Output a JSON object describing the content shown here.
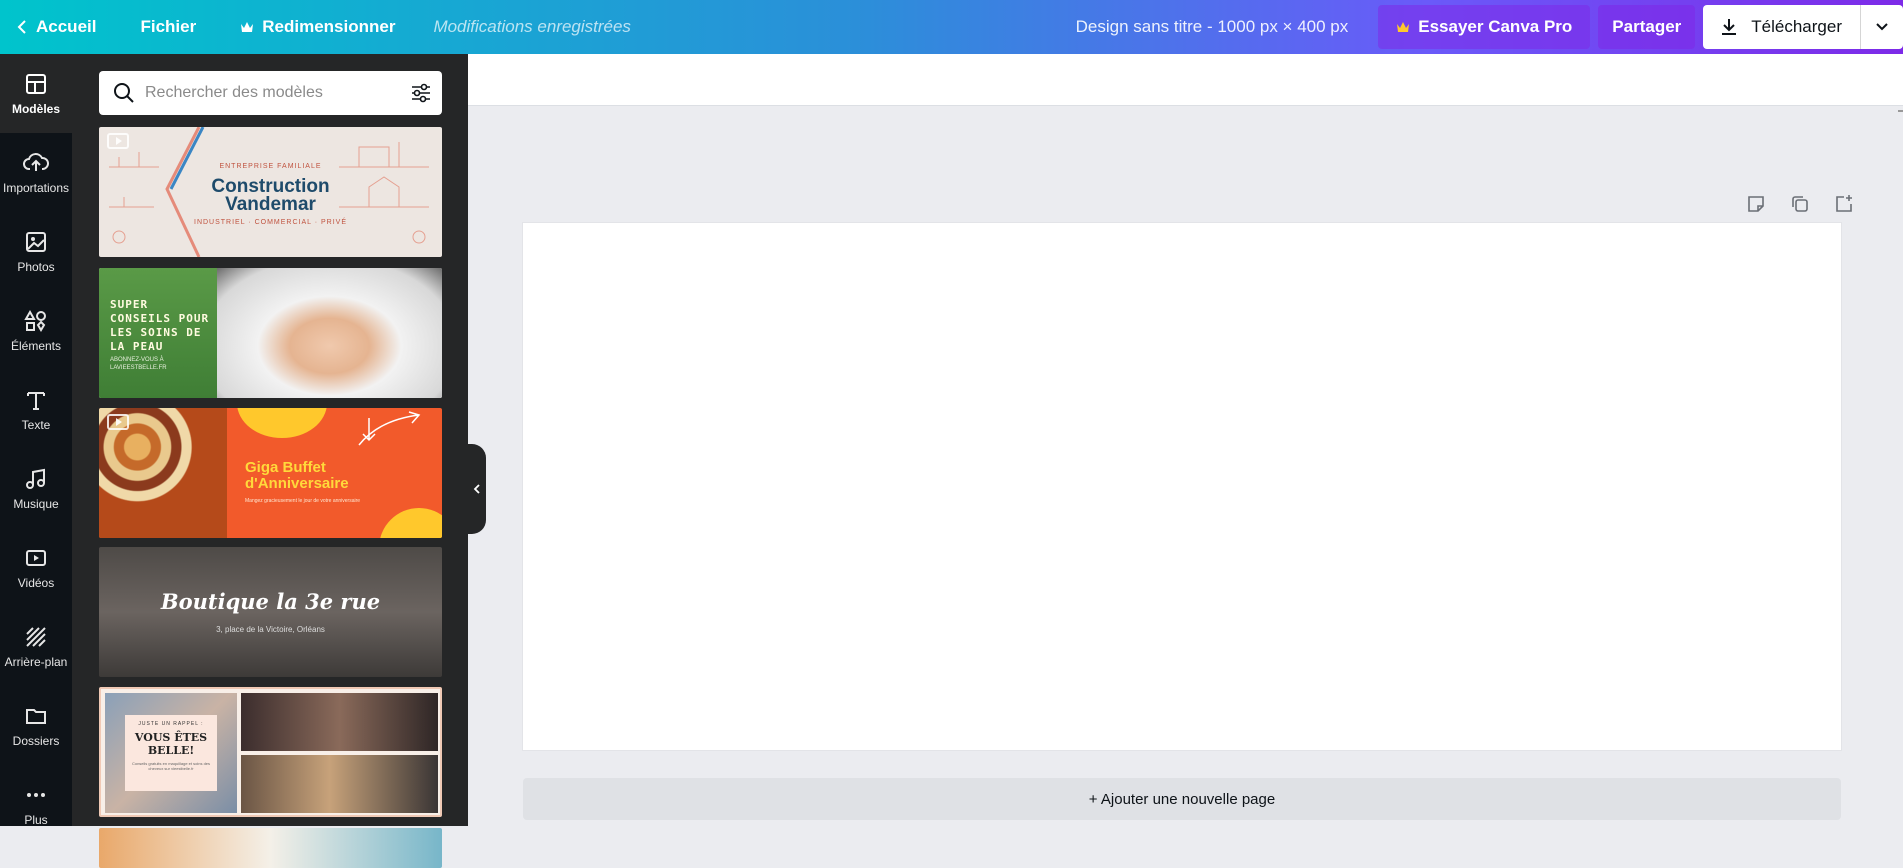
{
  "topbar": {
    "home_label": "Accueil",
    "file_label": "Fichier",
    "resize_label": "Redimensionner",
    "saved_status": "Modifications enregistrées",
    "design_title": "Design sans titre - 1000 px × 400 px",
    "pro_label": "Essayer Canva Pro",
    "share_label": "Partager",
    "download_label": "Télécharger"
  },
  "rail": {
    "items": [
      {
        "label": "Modèles",
        "icon": "templates-icon"
      },
      {
        "label": "Importations",
        "icon": "upload-cloud-icon"
      },
      {
        "label": "Photos",
        "icon": "image-icon"
      },
      {
        "label": "Éléments",
        "icon": "shapes-icon"
      },
      {
        "label": "Texte",
        "icon": "text-icon"
      },
      {
        "label": "Musique",
        "icon": "music-note-icon"
      },
      {
        "label": "Vidéos",
        "icon": "video-icon"
      },
      {
        "label": "Arrière-plan",
        "icon": "background-pattern-icon"
      },
      {
        "label": "Dossiers",
        "icon": "folder-icon"
      },
      {
        "label": "Plus",
        "icon": "more-dots-icon"
      }
    ]
  },
  "panel": {
    "search_placeholder": "Rechercher des modèles",
    "templates": {
      "t1": {
        "kicker": "ENTREPRISE FAMILIALE",
        "title_line1": "Construction",
        "title_line2": "Vandemar",
        "footer": "INDUSTRIEL · COMMERCIAL · PRIVÉ"
      },
      "t2": {
        "title": "SUPER CONSEILS POUR LES SOINS DE LA PEAU",
        "sub": "ABONNEZ-VOUS À LAVIEESTBELLE.FR"
      },
      "t3": {
        "title_line1": "Giga Buffet",
        "title_line2": "d'Anniversaire",
        "sub": "Mangez gracieusement le jour de votre anniversaire"
      },
      "t4": {
        "title": "Boutique la 3e rue",
        "sub": "3, place de la Victoire, Orléans"
      },
      "t5": {
        "kicker": "JUSTE UN RAPPEL :",
        "title_line1": "VOUS ÊTES",
        "title_line2": "BELLE!",
        "sub": "Conseils gratuits en maquillage et soins des cheveux sur vieestbelle.fr"
      }
    }
  },
  "canvas": {
    "add_page_label": "+ Ajouter une nouvelle page"
  },
  "colors": {
    "gradient_start": "#00c4cc",
    "gradient_end": "#7d2ae8",
    "rail_bg": "#0e1318",
    "panel_bg": "#252627",
    "workspace_bg": "#ebecf0"
  }
}
